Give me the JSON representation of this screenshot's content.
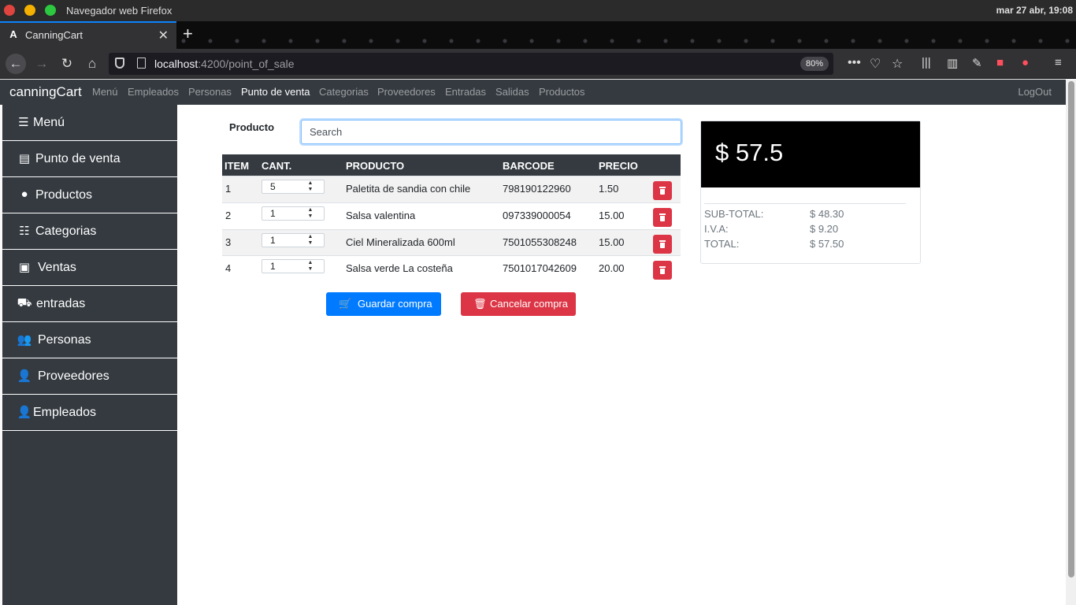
{
  "os": {
    "window_title": "Navegador web Firefox",
    "clock": "mar 27 abr, 19:08"
  },
  "browser": {
    "tab_title": "CanningCart",
    "url_host": "localhost",
    "url_path": ":4200/point_of_sale",
    "zoom": "80%"
  },
  "header": {
    "brand": "canningCart",
    "menu": [
      "Menú",
      "Empleados",
      "Personas",
      "Punto de venta",
      "Categorias",
      "Proveedores",
      "Entradas",
      "Salidas",
      "Productos"
    ],
    "active_menu": "Punto de venta",
    "logout": "LogOut"
  },
  "sidebar": {
    "items": [
      {
        "label": "Menú",
        "icon": "bars-icon"
      },
      {
        "label": "Punto de venta",
        "icon": "cash-register-icon"
      },
      {
        "label": "Productos",
        "icon": "cookie-icon"
      },
      {
        "label": "Categorias",
        "icon": "list-icon"
      },
      {
        "label": "Ventas",
        "icon": "money-bill-icon"
      },
      {
        "label": "entradas",
        "icon": "cart-icon"
      },
      {
        "label": "Personas",
        "icon": "users-icon"
      },
      {
        "label": "Proveedores",
        "icon": "user-cog-icon"
      },
      {
        "label": "Empleados",
        "icon": "user-tie-icon"
      }
    ]
  },
  "pos": {
    "product_label": "Producto",
    "search_placeholder": "Search",
    "columns": [
      "ITEM",
      "CANT.",
      "PRODUCTO",
      "BARCODE",
      "PRECIO"
    ],
    "rows": [
      {
        "item": "1",
        "qty": "5",
        "product": "Paletita de sandia con chile",
        "barcode": "798190122960",
        "price": "1.50"
      },
      {
        "item": "2",
        "qty": "1",
        "product": "Salsa valentina",
        "barcode": "097339000054",
        "price": "15.00"
      },
      {
        "item": "3",
        "qty": "1",
        "product": "Ciel Mineralizada 600ml",
        "barcode": "7501055308248",
        "price": "15.00"
      },
      {
        "item": "4",
        "qty": "1",
        "product": "Salsa verde La costeña",
        "barcode": "7501017042609",
        "price": "20.00"
      }
    ],
    "save_button": "Guardar compra",
    "cancel_button": "Cancelar compra"
  },
  "totals": {
    "big_total": "$ 57.5",
    "subtotal_label": "SUB-TOTAL:",
    "subtotal_value": "$ 48.30",
    "iva_label": "I.V.A:",
    "iva_value": "$ 9.20",
    "total_label": "TOTAL:",
    "total_value": "$ 57.50"
  },
  "colors": {
    "primary": "#007bff",
    "danger": "#dc3545",
    "dark": "#343a40"
  }
}
